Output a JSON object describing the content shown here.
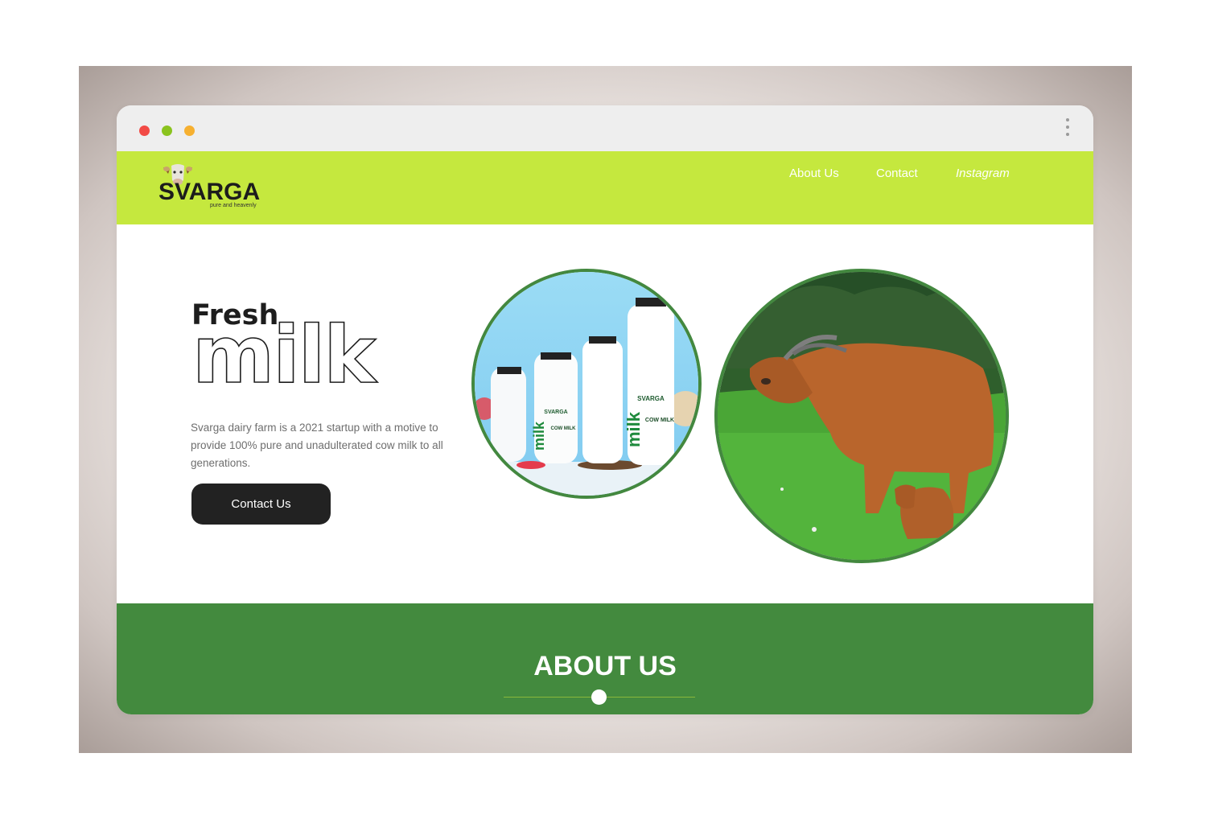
{
  "window": {
    "controls": [
      "close",
      "minimize",
      "maximize"
    ],
    "menu_icon": "kebab-menu-icon"
  },
  "brand": {
    "name": "SVARGA",
    "tagline": "pure and heavenly",
    "logo_icon": "cow-head-icon"
  },
  "nav": {
    "about": "About Us",
    "contact": "Contact",
    "instagram": "Instagram"
  },
  "hero": {
    "title_line1": "Fresh",
    "title_line2": "milk",
    "description": "Svarga dairy farm is a 2021 startup with a motive to provide 100% pure and unadulterated cow milk to all generations.",
    "cta_label": "Contact Us"
  },
  "images": {
    "milk_bottles": {
      "brand_label": "SVARGA",
      "product_word": "milk",
      "product_label": "COW MILK"
    },
    "cow_photo": "cow-and-calf-in-field"
  },
  "about": {
    "title": "ABOUT US"
  },
  "colors": {
    "nav_bg": "#c5e83e",
    "section_green": "#438a3e",
    "button_dark": "#222222",
    "titlebar": "#eeeeee"
  }
}
